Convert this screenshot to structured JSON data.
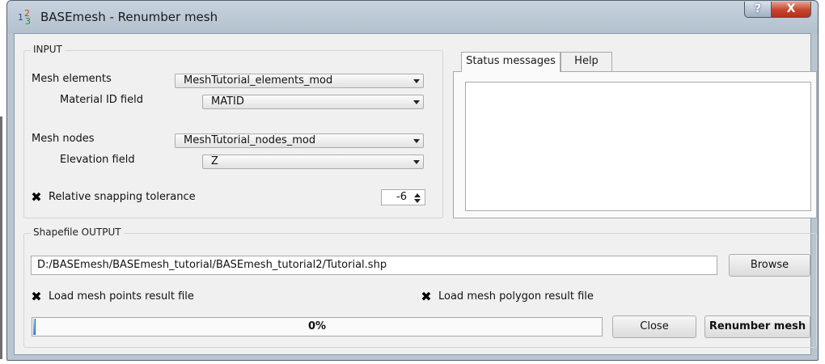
{
  "window": {
    "title": "BASEmesh - Renumber mesh",
    "icon": "numbers-icon",
    "icon_digits": [
      "1",
      "2",
      "3"
    ],
    "help_label": "?",
    "close_label": "X"
  },
  "input": {
    "group_title": "INPUT",
    "mesh_elements_label": "Mesh elements",
    "mesh_elements_value": "MeshTutorial_elements_mod",
    "material_id_label": "Material ID field",
    "material_id_value": "MATID",
    "mesh_nodes_label": "Mesh nodes",
    "mesh_nodes_value": "MeshTutorial_nodes_mod",
    "elevation_label": "Elevation field",
    "elevation_value": "Z",
    "snapping_label": "Relative snapping tolerance",
    "snapping_checked": true,
    "snapping_mark": "✖",
    "snapping_value": "-6"
  },
  "tabs": [
    {
      "label": "Status messages",
      "active": true
    },
    {
      "label": "Help",
      "active": false
    }
  ],
  "output": {
    "group_title": "Shapefile OUTPUT",
    "path_value": "D:/BASEmesh/BASEmesh_tutorial/BASEmesh_tutorial2/Tutorial.shp",
    "browse_label": "Browse",
    "load_points_label": "Load mesh points result file",
    "load_points_checked": true,
    "load_points_mark": "✖",
    "load_polygon_label": "Load mesh polygon result file",
    "load_polygon_checked": true,
    "load_polygon_mark": "✖",
    "progress_text": "0%",
    "progress_fraction": 0.0,
    "close_label": "Close",
    "renumber_label": "Renumber mesh"
  }
}
